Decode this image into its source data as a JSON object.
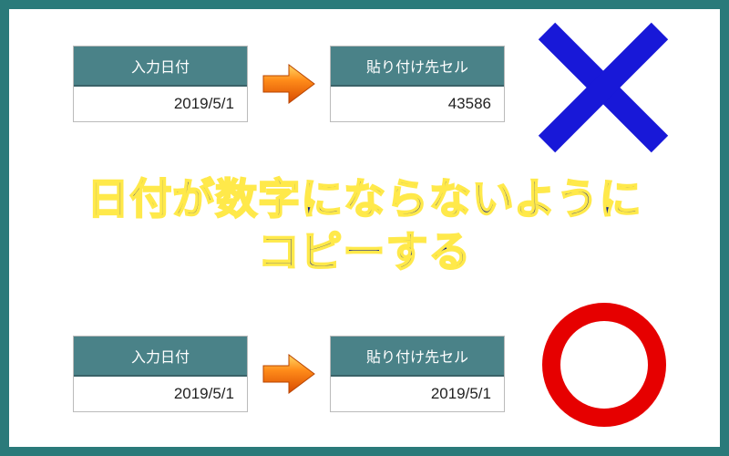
{
  "headline": {
    "line1": "日付が数字にならないように",
    "line2": "コピーする"
  },
  "top_row": {
    "left_header": "入力日付",
    "left_value": "2019/5/1",
    "right_header": "貼り付け先セル",
    "right_value": "43586"
  },
  "bottom_row": {
    "left_header": "入力日付",
    "left_value": "2019/5/1",
    "right_header": "貼り付け先セル",
    "right_value": "2019/5/1"
  },
  "marks": {
    "x_color": "#1818d8",
    "circle_color": "#e60000"
  },
  "arrow": {
    "gradient_start": "#ffd966",
    "gradient_mid": "#ff8c1a",
    "gradient_end": "#d84a00"
  }
}
